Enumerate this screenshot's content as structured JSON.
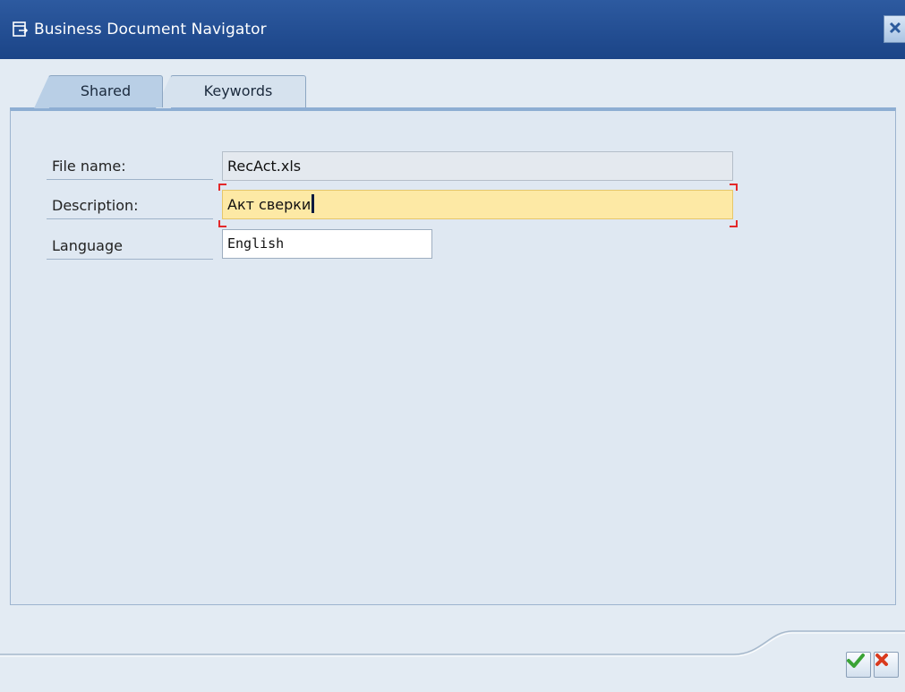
{
  "window": {
    "title": "Business Document Navigator",
    "icon": "dialog-icon",
    "close_icon": "close-icon"
  },
  "tabs": [
    {
      "label": "Shared",
      "active": true
    },
    {
      "label": "Keywords",
      "active": false
    }
  ],
  "form": {
    "file_name": {
      "label": "File name:",
      "value": "RecAct.xls",
      "editable": false
    },
    "description": {
      "label": "Description:",
      "value": "Акт сверки",
      "focused": true
    },
    "language": {
      "label": "Language",
      "value": "English"
    }
  },
  "footer": {
    "confirm_icon": "checkmark-icon",
    "cancel_icon": "cancel-x-icon"
  },
  "colors": {
    "title_bar": "#1f4a8f",
    "focused_field": "#fde9a5",
    "focus_corners": "#e3282a",
    "confirm_green": "#3aa335",
    "cancel_red": "#d93a1e"
  }
}
